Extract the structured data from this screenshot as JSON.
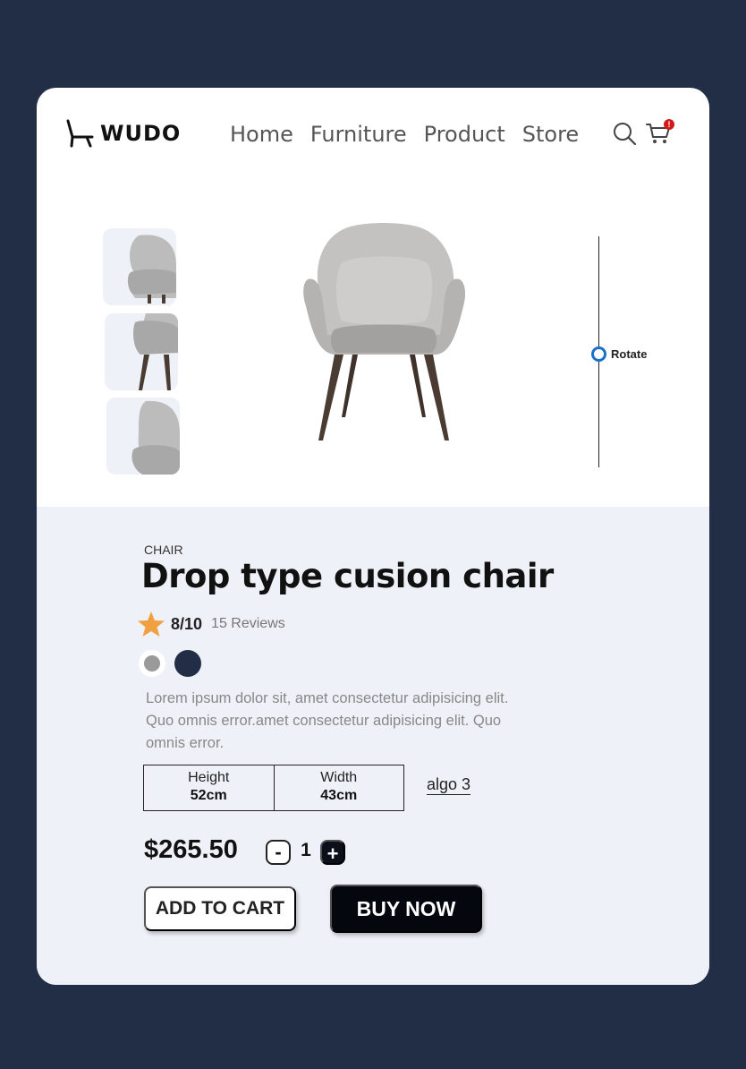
{
  "header": {
    "logo_text": "WUDO",
    "logo_icon": "chair-logo-icon",
    "nav": [
      {
        "label": "Home"
      },
      {
        "label": "Furniture"
      },
      {
        "label": "Product"
      },
      {
        "label": "Store"
      }
    ],
    "search_icon": "search-icon",
    "cart_icon": "cart-icon",
    "cart_badge": "!"
  },
  "gallery": {
    "thumbnail_count": 3,
    "main_image": "chair-image",
    "rotate_label": "Rotate"
  },
  "product": {
    "category": "CHAIR",
    "title": "Drop type cusion chair",
    "rating": "8/10",
    "reviews": "15 Reviews",
    "colors": [
      "#9a9a9a",
      "#222e46"
    ],
    "description": "Lorem ipsum dolor sit, amet consectetur adipisicing elit. Quo omnis error.amet consectetur adipisicing elit. Quo omnis error.",
    "dimensions": [
      {
        "label": "Height",
        "value": "52cm"
      },
      {
        "label": "Width",
        "value": "43cm"
      }
    ],
    "extra_link": "algo 3",
    "price": "$265.50",
    "quantity": "1",
    "qty_minus": "-",
    "qty_plus": "+",
    "add_to_cart": "ADD TO CART",
    "buy_now": "BUY NOW"
  },
  "colors": {
    "background": "#222e46",
    "card": "#ffffff",
    "info_panel": "#eef1f8",
    "accent_rotate": "#1a6fc9",
    "star": "#f0a040",
    "badge": "#d11a1a"
  }
}
